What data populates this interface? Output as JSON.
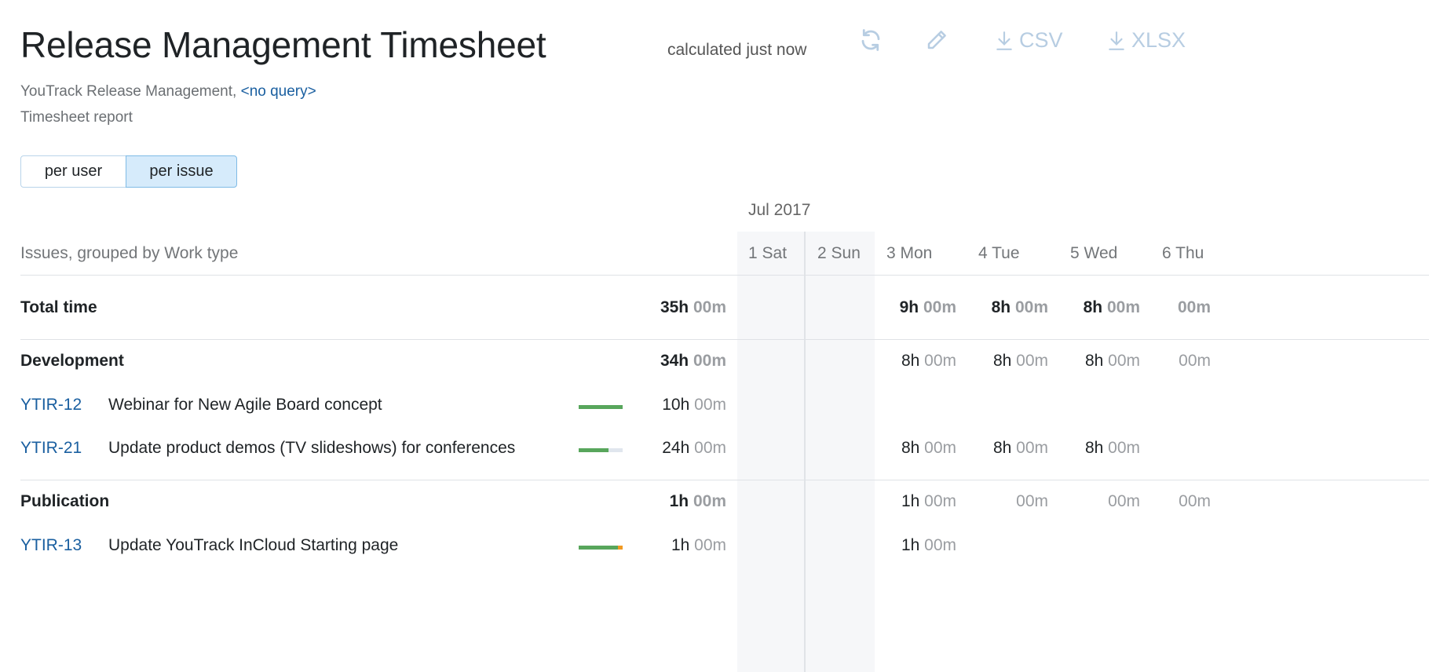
{
  "page": {
    "title": "Release Management Timesheet",
    "calculated": "calculated just now",
    "toolbar": {
      "refresh_icon": "refresh-icon",
      "edit_icon": "pencil-icon",
      "csv_label": "CSV",
      "xlsx_label": "XLSX"
    },
    "project": "YouTrack Release Management,",
    "query_link": "<no query>",
    "report_type": "Timesheet report"
  },
  "segmented": {
    "per_user": "per user",
    "per_issue": "per issue",
    "selected": "per issue"
  },
  "table": {
    "month": "Jul 2017",
    "group_header": "Issues, grouped by Work type",
    "days": [
      "1 Sat",
      "2 Sun",
      "3 Mon",
      "4 Tue",
      "5 Wed",
      "6 Thu"
    ],
    "total": {
      "label": "Total time",
      "sum": {
        "h": "35h",
        "m": "00m"
      },
      "days": [
        null,
        null,
        {
          "h": "9h",
          "m": "00m"
        },
        {
          "h": "8h",
          "m": "00m"
        },
        {
          "h": "8h",
          "m": "00m"
        },
        {
          "h": "",
          "m": "00m"
        }
      ]
    },
    "groups": [
      {
        "label": "Development",
        "sum": {
          "h": "34h",
          "m": "00m"
        },
        "days": [
          null,
          null,
          {
            "h": "8h",
            "m": "00m"
          },
          {
            "h": "8h",
            "m": "00m"
          },
          {
            "h": "8h",
            "m": "00m"
          },
          {
            "h": "",
            "m": "00m"
          }
        ],
        "issues": [
          {
            "id": "YTIR-12",
            "summary": "Webinar for New Agile Board concept",
            "progress": 1.0,
            "overrun": 0,
            "sum": {
              "h": "10h",
              "m": "00m"
            },
            "days": [
              null,
              null,
              null,
              null,
              null,
              null
            ]
          },
          {
            "id": "YTIR-21",
            "summary": "Update product demos (TV slideshows) for conferences",
            "progress": 0.68,
            "overrun": 0,
            "sum": {
              "h": "24h",
              "m": "00m"
            },
            "days": [
              null,
              null,
              {
                "h": "8h",
                "m": "00m"
              },
              {
                "h": "8h",
                "m": "00m"
              },
              {
                "h": "8h",
                "m": "00m"
              },
              null
            ]
          }
        ]
      },
      {
        "label": "Publication",
        "sum": {
          "h": "1h",
          "m": "00m"
        },
        "days": [
          null,
          null,
          {
            "h": "1h",
            "m": "00m"
          },
          {
            "h": "",
            "m": "00m"
          },
          {
            "h": "",
            "m": "00m"
          },
          {
            "h": "",
            "m": "00m"
          }
        ],
        "issues": [
          {
            "id": "YTIR-13",
            "summary": "Update YouTrack InCloud Starting page",
            "progress": 0.9,
            "overrun": 0.1,
            "sum": {
              "h": "1h",
              "m": "00m"
            },
            "days": [
              null,
              null,
              {
                "h": "1h",
                "m": "00m"
              },
              null,
              null,
              null
            ]
          }
        ]
      }
    ]
  }
}
